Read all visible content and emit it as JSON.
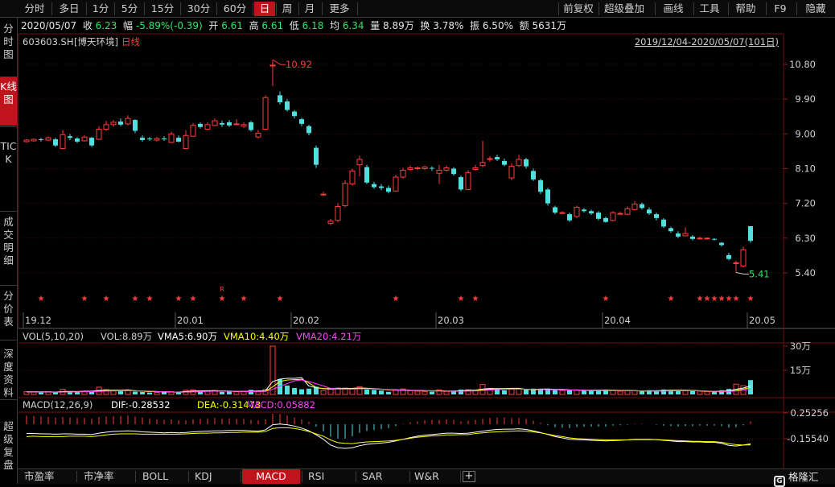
{
  "toolbar": {
    "periods": [
      "分时",
      "多日",
      "1分",
      "5分",
      "15分",
      "30分",
      "60分",
      "日",
      "周",
      "月",
      "更多"
    ],
    "active_period": "日",
    "right_items": [
      "前复权",
      "超级叠加",
      "画线",
      "工具",
      "帮助",
      "F9",
      "隐藏"
    ]
  },
  "leftnav": [
    "分时图",
    "K线图",
    "TICK",
    "成交明细",
    "分价表",
    "深度资料",
    "超级复盘"
  ],
  "leftnav_active": "K线图",
  "quote": {
    "date": "2020/05/07",
    "close_label": "收",
    "close": "6.23",
    "change_label": "幅",
    "change": "-5.89%(-0.39)",
    "open_label": "开",
    "open": "6.61",
    "high_label": "高",
    "high": "6.61",
    "low_label": "低",
    "low": "6.18",
    "avg_label": "均",
    "avg": "6.34",
    "volume_label": "量",
    "volume": "8.89万",
    "turnover_label": "换",
    "turnover": "3.78%",
    "amplitude_label": "振",
    "amplitude": "6.50%",
    "amount_label": "额",
    "amount": "5631万"
  },
  "stock": {
    "code": "603603.SH",
    "name": "[博天环境]",
    "period": "日线"
  },
  "range_label": "2019/12/04-2020/05/07(101日)",
  "price_axis": {
    "ticks": [
      "10.80",
      "9.90",
      "9.00",
      "8.10",
      "7.20",
      "6.30",
      "5.40"
    ],
    "min": 5.0,
    "max": 11.2
  },
  "date_axis": [
    "19.12",
    "20.01",
    "20.02",
    "20.03",
    "20.04",
    "20.05"
  ],
  "annotations": {
    "high_label": "10.92",
    "low_label": "5.41",
    "r_marker": "R"
  },
  "vol_panel": {
    "title": "VOL(5,10,20)",
    "vol": "VOL:8.89万",
    "vma5": "VMA5:6.90万",
    "vma10": "VMA10:4.40万",
    "vma20": "VMA20:4.21万",
    "ticks": [
      "30万",
      "15万"
    ],
    "colors": {
      "vma5": "#ffffff",
      "vma10": "#ffff00",
      "vma20": "#ff44ff"
    }
  },
  "macd_panel": {
    "title": "MACD(12,26,9)",
    "dif": "DIF:-0.28532",
    "dea": "DEA:-0.31473",
    "macd": "MACD:0.05882",
    "ticks": [
      "0.25256",
      "-0.15540"
    ]
  },
  "indicator_tabs": [
    "市盈率",
    "市净率",
    "BOLL",
    "KDJ",
    "MACD",
    "RSI",
    "SAR",
    "W&R"
  ],
  "indicator_active": "MACD",
  "logo_text": "格隆汇",
  "colors": {
    "up": "#ff3c3c",
    "down": "#4fe0e0",
    "active_tab": "#c0141c"
  },
  "chart_data": {
    "type": "candlestick",
    "title": "",
    "ylim": [
      5.0,
      11.2
    ],
    "candles": [
      [
        8.8,
        8.84,
        8.86,
        8.78
      ],
      [
        8.82,
        8.86,
        8.88,
        8.8
      ],
      [
        8.86,
        8.84,
        8.9,
        8.8
      ],
      [
        8.84,
        8.9,
        8.94,
        8.82
      ],
      [
        8.86,
        8.7,
        8.9,
        8.66
      ],
      [
        8.62,
        8.98,
        9.1,
        8.6
      ],
      [
        8.94,
        8.9,
        9.0,
        8.84
      ],
      [
        8.88,
        8.8,
        8.92,
        8.76
      ],
      [
        8.82,
        8.92,
        8.96,
        8.8
      ],
      [
        8.9,
        8.7,
        8.92,
        8.66
      ],
      [
        8.86,
        9.12,
        9.2,
        8.84
      ],
      [
        9.12,
        9.24,
        9.34,
        9.08
      ],
      [
        9.24,
        9.3,
        9.36,
        9.18
      ],
      [
        9.32,
        9.24,
        9.4,
        9.2
      ],
      [
        9.26,
        9.4,
        9.48,
        9.22
      ],
      [
        9.36,
        9.08,
        9.38,
        9.02
      ],
      [
        8.9,
        8.84,
        8.96,
        8.8
      ],
      [
        8.88,
        8.86,
        8.92,
        8.82
      ],
      [
        8.84,
        8.88,
        8.92,
        8.8
      ],
      [
        8.88,
        8.86,
        8.94,
        8.82
      ],
      [
        8.78,
        9.0,
        9.06,
        8.76
      ],
      [
        8.9,
        8.8,
        8.96,
        8.78
      ],
      [
        8.62,
        8.96,
        9.1,
        8.6
      ],
      [
        8.94,
        9.22,
        9.28,
        8.92
      ],
      [
        9.26,
        9.18,
        9.3,
        9.14
      ],
      [
        9.12,
        9.24,
        9.3,
        9.1
      ],
      [
        9.22,
        9.34,
        9.4,
        9.2
      ],
      [
        9.28,
        9.24,
        9.34,
        9.18
      ],
      [
        9.3,
        9.22,
        9.36,
        9.18
      ],
      [
        9.26,
        9.26,
        9.38,
        9.22
      ],
      [
        9.2,
        9.24,
        9.3,
        9.16
      ],
      [
        9.3,
        9.1,
        9.34,
        9.06
      ],
      [
        8.92,
        9.02,
        9.1,
        8.88
      ],
      [
        9.12,
        9.94,
        10.0,
        9.1
      ],
      [
        10.78,
        10.78,
        10.92,
        10.24
      ],
      [
        10.0,
        9.82,
        10.1,
        9.76
      ],
      [
        9.84,
        9.62,
        9.9,
        9.58
      ],
      [
        9.58,
        9.46,
        9.62,
        9.4
      ],
      [
        9.38,
        9.26,
        9.42,
        9.2
      ],
      [
        9.2,
        9.02,
        9.24,
        8.96
      ],
      [
        8.64,
        8.2,
        8.7,
        8.12
      ],
      [
        7.44,
        7.44,
        7.5,
        7.4
      ],
      [
        6.68,
        6.74,
        6.8,
        6.64
      ],
      [
        6.76,
        7.12,
        7.2,
        6.72
      ],
      [
        7.14,
        7.72,
        7.8,
        7.1
      ],
      [
        7.7,
        8.04,
        8.1,
        7.66
      ],
      [
        8.2,
        8.34,
        8.44,
        7.9
      ],
      [
        8.14,
        7.74,
        8.2,
        7.7
      ],
      [
        7.7,
        7.62,
        7.76,
        7.58
      ],
      [
        7.64,
        7.6,
        7.7,
        7.54
      ],
      [
        7.6,
        7.5,
        7.66,
        7.46
      ],
      [
        7.52,
        7.88,
        7.94,
        7.5
      ],
      [
        7.88,
        8.06,
        8.12,
        7.84
      ],
      [
        8.08,
        8.12,
        8.18,
        8.04
      ],
      [
        8.1,
        8.12,
        8.16,
        8.06
      ],
      [
        8.1,
        8.14,
        8.18,
        8.06
      ],
      [
        8.12,
        8.1,
        8.16,
        8.04
      ],
      [
        7.98,
        8.06,
        8.2,
        7.7
      ],
      [
        8.06,
        8.12,
        8.18,
        8.02
      ],
      [
        8.1,
        7.96,
        8.14,
        7.92
      ],
      [
        7.88,
        7.56,
        7.92,
        7.52
      ],
      [
        7.56,
        8.0,
        8.06,
        7.54
      ],
      [
        8.08,
        8.12,
        8.2,
        8.04
      ],
      [
        8.18,
        8.26,
        8.82,
        8.14
      ],
      [
        8.34,
        8.36,
        8.42,
        8.28
      ],
      [
        8.4,
        8.34,
        8.46,
        8.3
      ],
      [
        8.3,
        8.2,
        8.36,
        8.16
      ],
      [
        7.86,
        8.16,
        8.24,
        7.8
      ],
      [
        8.18,
        8.34,
        8.46,
        8.14
      ],
      [
        8.34,
        8.16,
        8.38,
        8.1
      ],
      [
        8.04,
        7.82,
        8.1,
        7.78
      ],
      [
        7.8,
        7.5,
        7.84,
        7.44
      ],
      [
        7.56,
        7.2,
        7.6,
        7.14
      ],
      [
        7.1,
        6.96,
        7.14,
        6.92
      ],
      [
        6.96,
        6.96,
        7.0,
        6.92
      ],
      [
        6.92,
        6.76,
        6.96,
        6.72
      ],
      [
        6.86,
        7.1,
        7.14,
        6.82
      ],
      [
        7.04,
        7.0,
        7.08,
        6.96
      ],
      [
        7.0,
        6.94,
        7.04,
        6.9
      ],
      [
        6.96,
        6.8,
        7.0,
        6.76
      ],
      [
        6.82,
        6.72,
        6.86,
        6.7
      ],
      [
        6.76,
        6.96,
        7.0,
        6.74
      ],
      [
        6.94,
        6.94,
        6.98,
        6.9
      ],
      [
        6.92,
        7.06,
        7.12,
        6.9
      ],
      [
        7.04,
        7.18,
        7.26,
        7.02
      ],
      [
        7.18,
        7.08,
        7.22,
        7.04
      ],
      [
        7.04,
        6.94,
        7.1,
        6.9
      ],
      [
        6.92,
        6.82,
        6.96,
        6.76
      ],
      [
        6.78,
        6.6,
        6.82,
        6.56
      ],
      [
        6.56,
        6.48,
        6.6,
        6.44
      ],
      [
        6.42,
        6.34,
        6.48,
        6.3
      ],
      [
        6.36,
        6.42,
        6.58,
        6.34
      ],
      [
        6.34,
        6.28,
        6.38,
        6.24
      ],
      [
        6.3,
        6.3,
        6.34,
        6.26
      ],
      [
        6.28,
        6.3,
        6.32,
        6.26
      ],
      [
        6.28,
        6.26,
        6.3,
        6.24
      ],
      [
        6.18,
        6.12,
        6.2,
        6.08
      ],
      [
        5.86,
        5.76,
        5.92,
        5.72
      ],
      [
        5.64,
        5.66,
        5.72,
        5.41
      ],
      [
        5.58,
        6.0,
        6.08,
        5.54
      ],
      [
        6.61,
        6.23,
        6.61,
        6.18
      ]
    ],
    "volumes": [
      1.7,
      1.6,
      1.4,
      1.6,
      1.3,
      3.2,
      2.0,
      1.6,
      1.8,
      1.5,
      4.5,
      3.0,
      2.2,
      2.0,
      2.6,
      1.8,
      1.5,
      1.2,
      1.3,
      1.6,
      1.8,
      1.6,
      2.6,
      2.9,
      2.3,
      2.0,
      2.4,
      1.6,
      1.8,
      1.7,
      2.0,
      2.8,
      2.2,
      3.2,
      30.0,
      9.5,
      5.5,
      4.0,
      3.2,
      3.6,
      4.8,
      2.4,
      3.8,
      4.0,
      4.0,
      3.6,
      4.8,
      3.0,
      2.8,
      2.4,
      1.6,
      3.0,
      3.4,
      2.2,
      2.0,
      1.8,
      1.7,
      2.8,
      1.9,
      2.3,
      3.0,
      2.9,
      2.2,
      6.2,
      3.8,
      3.2,
      2.6,
      3.2,
      3.4,
      3.0,
      3.6,
      3.2,
      3.6,
      2.8,
      2.4,
      2.6,
      2.8,
      2.6,
      2.4,
      2.8,
      3.0,
      2.4,
      2.0,
      2.2,
      2.4,
      2.0,
      2.6,
      2.4,
      3.0,
      2.8,
      2.4,
      2.2,
      2.0,
      2.0,
      1.8,
      1.8,
      2.6,
      3.4,
      6.4,
      5.4,
      8.89
    ],
    "vma5": [
      1.6,
      1.6,
      1.6,
      1.6,
      1.5,
      1.8,
      1.9,
      1.8,
      2.0,
      2.0,
      2.5,
      2.6,
      2.6,
      2.6,
      2.9,
      2.3,
      2.0,
      1.9,
      1.8,
      1.7,
      1.5,
      1.5,
      1.8,
      2.1,
      2.2,
      2.3,
      2.4,
      2.2,
      2.1,
      1.9,
      1.9,
      2.0,
      2.1,
      2.3,
      8.0,
      9.5,
      10.0,
      10.0,
      10.4,
      5.2,
      4.2,
      3.6,
      3.6,
      3.7,
      3.7,
      3.8,
      4.0,
      3.9,
      3.6,
      3.3,
      2.9,
      2.8,
      2.8,
      2.6,
      2.5,
      2.4,
      2.3,
      2.3,
      2.1,
      2.1,
      2.3,
      2.6,
      2.6,
      3.4,
      3.6,
      3.6,
      3.6,
      3.8,
      3.8,
      3.1,
      3.2,
      3.3,
      3.4,
      3.1,
      3.1,
      2.9,
      2.8,
      2.6,
      2.6,
      2.6,
      2.7,
      2.6,
      2.5,
      2.5,
      2.4,
      2.2,
      2.3,
      2.3,
      2.5,
      2.6,
      2.6,
      2.6,
      2.5,
      2.3,
      2.0,
      2.0,
      2.0,
      2.3,
      3.2,
      4.0,
      5.3
    ],
    "macd_hist": [
      0.18,
      0.17,
      0.16,
      0.15,
      0.14,
      0.15,
      0.14,
      0.13,
      0.13,
      0.12,
      0.15,
      0.16,
      0.17,
      0.17,
      0.18,
      0.16,
      0.14,
      0.12,
      0.1,
      0.09,
      0.1,
      0.08,
      0.08,
      0.1,
      0.11,
      0.12,
      0.13,
      0.12,
      0.12,
      0.11,
      0.11,
      0.09,
      0.08,
      0.1,
      0.22,
      0.21,
      0.18,
      0.14,
      0.1,
      0.05,
      -0.05,
      -0.15,
      -0.26,
      -0.3,
      -0.3,
      -0.25,
      -0.18,
      -0.14,
      -0.12,
      -0.1,
      -0.08,
      -0.04,
      0.01,
      0.04,
      0.06,
      0.08,
      0.09,
      0.09,
      0.1,
      0.09,
      0.06,
      0.07,
      0.09,
      0.11,
      0.13,
      0.14,
      0.14,
      0.13,
      0.13,
      0.11,
      0.07,
      0.03,
      -0.02,
      -0.06,
      -0.07,
      -0.08,
      -0.06,
      -0.05,
      -0.05,
      -0.05,
      -0.05,
      -0.03,
      -0.02,
      -0.01,
      0.01,
      0.01,
      0.0,
      -0.01,
      -0.03,
      -0.04,
      -0.05,
      -0.04,
      -0.04,
      -0.03,
      -0.03,
      -0.03,
      -0.04,
      -0.07,
      -0.06,
      -0.02,
      0.06
    ],
    "dif": [
      0.02,
      0.02,
      0.01,
      0.01,
      0.0,
      0.01,
      0.01,
      0.0,
      0.0,
      -0.01,
      0.03,
      0.06,
      0.08,
      0.09,
      0.1,
      0.09,
      0.07,
      0.06,
      0.05,
      0.04,
      0.05,
      0.04,
      0.05,
      0.07,
      0.08,
      0.09,
      0.1,
      0.1,
      0.11,
      0.11,
      0.11,
      0.1,
      0.09,
      0.13,
      0.28,
      0.3,
      0.28,
      0.24,
      0.18,
      0.1,
      -0.02,
      -0.15,
      -0.32,
      -0.4,
      -0.42,
      -0.4,
      -0.34,
      -0.3,
      -0.28,
      -0.26,
      -0.24,
      -0.2,
      -0.15,
      -0.1,
      -0.06,
      -0.03,
      -0.01,
      0.01,
      0.03,
      0.03,
      0.02,
      0.03,
      0.06,
      0.09,
      0.12,
      0.14,
      0.15,
      0.15,
      0.16,
      0.14,
      0.1,
      0.05,
      -0.01,
      -0.07,
      -0.11,
      -0.15,
      -0.16,
      -0.17,
      -0.18,
      -0.19,
      -0.2,
      -0.19,
      -0.18,
      -0.17,
      -0.15,
      -0.15,
      -0.15,
      -0.16,
      -0.18,
      -0.2,
      -0.22,
      -0.22,
      -0.23,
      -0.23,
      -0.24,
      -0.24,
      -0.27,
      -0.33,
      -0.35,
      -0.32,
      -0.28532
    ],
    "dea": [
      -0.07,
      -0.06,
      -0.07,
      -0.07,
      -0.07,
      -0.07,
      -0.06,
      -0.06,
      -0.06,
      -0.07,
      -0.05,
      -0.02,
      0.0,
      0.01,
      0.01,
      0.01,
      0.0,
      0.0,
      0.0,
      0.0,
      0.0,
      0.0,
      0.01,
      0.02,
      0.03,
      0.03,
      0.04,
      0.04,
      0.05,
      0.05,
      0.06,
      0.06,
      0.06,
      0.08,
      0.17,
      0.19,
      0.19,
      0.17,
      0.13,
      0.08,
      0.01,
      -0.06,
      -0.17,
      -0.25,
      -0.27,
      -0.28,
      -0.25,
      -0.23,
      -0.22,
      -0.21,
      -0.2,
      -0.18,
      -0.15,
      -0.12,
      -0.09,
      -0.07,
      -0.05,
      -0.04,
      -0.02,
      -0.02,
      -0.01,
      -0.01,
      0.02,
      0.04,
      0.06,
      0.07,
      0.08,
      0.09,
      0.1,
      0.09,
      0.07,
      0.04,
      0.0,
      -0.04,
      -0.07,
      -0.11,
      -0.13,
      -0.14,
      -0.15,
      -0.16,
      -0.17,
      -0.17,
      -0.17,
      -0.17,
      -0.16,
      -0.16,
      -0.16,
      -0.16,
      -0.17,
      -0.18,
      -0.19,
      -0.2,
      -0.21,
      -0.21,
      -0.22,
      -0.22,
      -0.24,
      -0.28,
      -0.31,
      -0.32,
      -0.31473
    ]
  }
}
